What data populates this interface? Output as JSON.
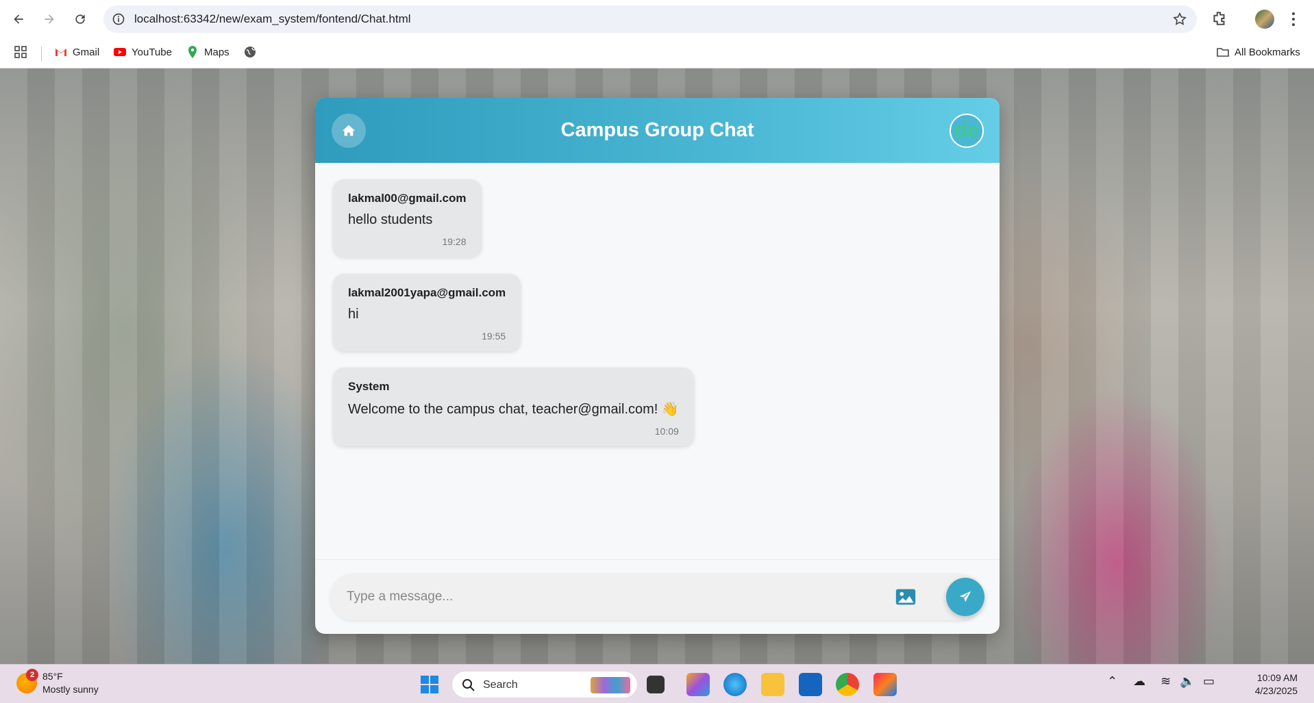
{
  "browser": {
    "url": "localhost:63342/new/exam_system/fontend/Chat.html",
    "bookmarks": [
      {
        "label": "Gmail"
      },
      {
        "label": "YouTube"
      },
      {
        "label": "Maps"
      }
    ],
    "all_bookmarks_label": "All Bookmarks"
  },
  "chat": {
    "title": "Campus Group Chat",
    "user_avatar_text": "de",
    "messages": [
      {
        "sender": "lakmal00@gmail.com",
        "text": "hello students",
        "time": "19:28"
      },
      {
        "sender": "lakmal2001yapa@gmail.com",
        "text": "hi",
        "time": "19:55"
      },
      {
        "sender": "System",
        "text": "Welcome to the campus chat, teacher@gmail.com! 👋",
        "time": "10:09"
      }
    ],
    "input_placeholder": "Type a message...",
    "accent_color": "#3aa9c7"
  },
  "taskbar": {
    "weather_temp": "85°F",
    "weather_desc": "Mostly sunny",
    "weather_badge": "2",
    "search_label": "Search",
    "time": "10:09 AM",
    "date": "4/23/2025"
  }
}
